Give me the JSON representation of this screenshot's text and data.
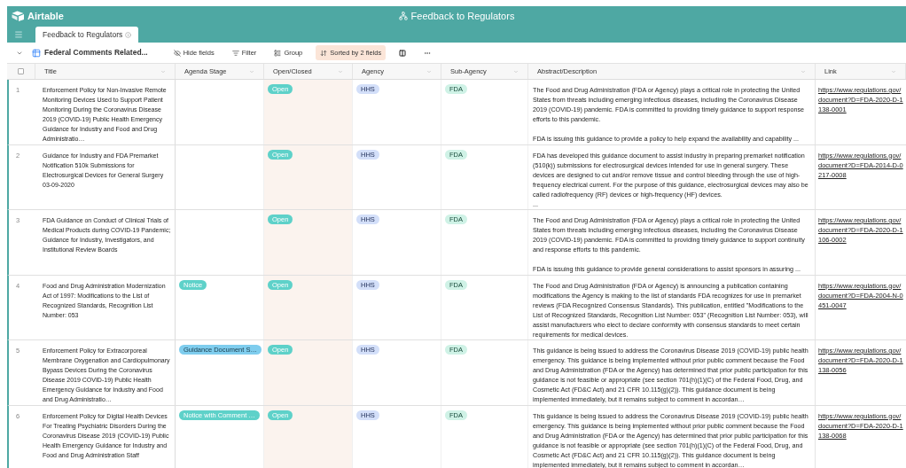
{
  "app": {
    "logo": "Airtable",
    "base_title": "Feedback to Regulators"
  },
  "tabs": [
    {
      "label": "Feedback to Regulators",
      "selected": true
    }
  ],
  "toolbar": {
    "view_name": "Federal Comments Related...",
    "buttons": [
      {
        "kind": "hide",
        "label": "Hide fields",
        "active": false
      },
      {
        "kind": "filter",
        "label": "Filter",
        "active": false
      },
      {
        "kind": "group",
        "label": "Group",
        "active": false
      },
      {
        "kind": "sort",
        "label": "Sorted by 2 fields",
        "active": true
      },
      {
        "kind": "height",
        "active": false
      },
      {
        "kind": "more",
        "active": false
      }
    ]
  },
  "table": {
    "select_all_checked": false,
    "columns": [
      {
        "label": "Title",
        "sorted": false
      },
      {
        "label": "Agenda Stage",
        "sorted": false
      },
      {
        "label": "Open/Closed",
        "sorted": true
      },
      {
        "label": "Agency",
        "sorted": false
      },
      {
        "label": "Sub-Agency",
        "sorted": false
      },
      {
        "label": "Abstract/Description",
        "sorted": false
      },
      {
        "label": "Link",
        "sorted": false
      }
    ],
    "rows": [
      {
        "number": "1",
        "title": "Enforcement Policy for Non-Invasive Remote Monitoring Devices Used to Support Patient Monitoring During the Coronavirus Disease 2019 (COVID-19) Public Health Emergency Guidance for Industry and Food and Drug Administratio…",
        "open_closed": "Open",
        "agency": "HHS",
        "sub_agency": "FDA",
        "abstract": "The Food and Drug Administration (FDA or Agency) plays a critical role in protecting the United States from threats including emerging infectious diseases, including the Coronavirus Disease 2019 (COVID-19) pandemic. FDA is committed to providing timely guidance to support response efforts to this pandemic.\n\nFDA is issuing this guidance to provide a policy to help expand the availability and capability ...",
        "link": "https://www.regulations.gov/document?D=FDA-2020-D-1138-0001"
      },
      {
        "number": "2",
        "title": "Guidance for Industry and FDA Premarket Notification 510k Submissions for Electrosurgical Devices for General Surgery 03-09-2020",
        "open_closed": "Open",
        "agency": "HHS",
        "sub_agency": "FDA",
        "abstract": "FDA has developed this guidance document to assist industry in preparing premarket notification (510(k)) submissions for electrosurgical devices intended for use in general surgery. These devices are designed to cut and/or remove tissue and control bleeding through the use of high-frequency electrical current. For the purpose of this guidance, electrosurgical devices may also be called radiofrequency (RF) devices or high-frequency (HF) devices.\n...",
        "link": "https://www.regulations.gov/document?D=FDA-2014-D-0217-0008"
      },
      {
        "number": "3",
        "title": "FDA Guidance on Conduct of Clinical Trials of Medical Products during COVID-19 Pandemic; Guidance for Industry, Investigators, and Institutional Review Boards",
        "open_closed": "Open",
        "agency": "HHS",
        "sub_agency": "FDA",
        "abstract": "The Food and Drug Administration (FDA or Agency) plays a critical role in protecting the United States from threats including emerging infectious diseases, including the Coronavirus Disease 2019 (COVID-19) pandemic. FDA is committed to providing timely guidance to support continuity and response efforts to this pandemic.\n\nFDA is issuing this guidance to provide general considerations to assist sponsors in assuring ...",
        "link": "https://www.regulations.gov/document?D=FDA-2020-D-1106-0002"
      },
      {
        "number": "4",
        "title": "Food and Drug Administration Modernization Act of 1997: Modifications to the List of Recognized Standards, Recognition List Number: 053",
        "agenda_stage": {
          "label": "Notice",
          "color": "#5ed1c9"
        },
        "open_closed": "Open",
        "agency": "HHS",
        "sub_agency": "FDA",
        "abstract": "The Food and Drug Administration (FDA or Agency) is announcing a publication containing modifications the Agency is making to the list of standards FDA recognizes for use in premarket reviews (FDA Recognized Consensus Standards). This publication, entitled \"Modifications to the List of Recognized Standards, Recognition List Number: 053\" (Recognition List Number: 053), will assist manufacturers who elect to declare conformity with consensus standards to meet certain requirements for medical devices.",
        "link": "https://www.regulations.gov/document?D=FDA-2004-N-0451-0047"
      },
      {
        "number": "5",
        "title": "Enforcement Policy for Extracorporeal Membrane Oxygenation and Cardiopulmonary Bypass Devices During the Coronavirus Disease 2019 COVID-19) Public Health Emergency Guidance for Industry and Food and Drug Administratio…",
        "agenda_stage": {
          "label": "Guidance Document S…",
          "color": "#7fcdee"
        },
        "open_closed": "Open",
        "agency": "HHS",
        "sub_agency": "FDA",
        "abstract": "This guidance is being issued to address the Coronavirus Disease 2019 (COVID-19) public health emergency. This guidance is being implemented without prior public comment because the Food and Drug Administration (FDA or the Agency) has determined that prior public participation for this guidance is not feasible or appropriate (see section 701(h)(1)(C) of the Federal Food, Drug, and Cosmetic Act (FD&C Act) and 21 CFR 10.115(g)(2)). This guidance document is being implemented immediately, but it remains subject to comment in accordan…",
        "link": "https://www.regulations.gov/document?D=FDA-2020-D-1138-0056"
      },
      {
        "number": "6",
        "title": "Enforcement Policy for Digital Health Devices For Treating Psychiatric Disorders During the Coronavirus Disease 2019 (COVID-19) Public Health Emergency Guidance for Industry and Food and Drug Administration Staff",
        "agenda_stage": {
          "label": "Notice with Comment …",
          "color": "#5ed1c9"
        },
        "open_closed": "Open",
        "agency": "HHS",
        "sub_agency": "FDA",
        "abstract": "This guidance is being issued to address the Coronavirus Disease 2019 (COVID-19) public health emergency. This guidance is being implemented without prior public comment because the Food and Drug Administration (FDA or the Agency) has determined that prior public participation for this guidance is not feasible or appropriate (see section 701(h)(1)(C) of the Federal Food, Drug, and Cosmetic Act (FD&C Act) and 21 CFR 10.115(g)(2)). This guidance document is being implemented immediately, but it remains subject to comment in accordan…",
        "link": "https://www.regulations.gov/document?D=FDA-2020-D-1138-0068"
      }
    ]
  }
}
